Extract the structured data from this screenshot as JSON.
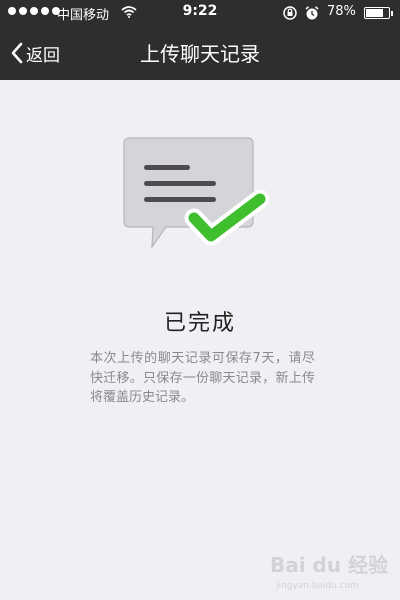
{
  "status_bar": {
    "carrier": "中国移动",
    "time": "9:22",
    "battery_percent": "78%",
    "battery_level": 0.78,
    "icons": [
      "signal-dots-icon",
      "wifi-icon",
      "rotation-lock-icon",
      "alarm-icon",
      "battery-icon"
    ]
  },
  "nav": {
    "back_label": "返回",
    "title": "上传聊天记录"
  },
  "main": {
    "illustration_icon": "chat-bubble-check-icon",
    "done_title": "已完成",
    "description": "本次上传的聊天记录可保存7天，请尽快迁移。只保存一份聊天记录，新上传将覆盖历史记录。"
  },
  "watermark": {
    "text": "Bai du 经验",
    "url": "jingyan.baidu.com"
  },
  "colors": {
    "header_bg": "#2e2e31",
    "page_bg": "#efeff4",
    "check_green": "#3fbf2e",
    "bubble_gray": "#d3d5d8"
  }
}
